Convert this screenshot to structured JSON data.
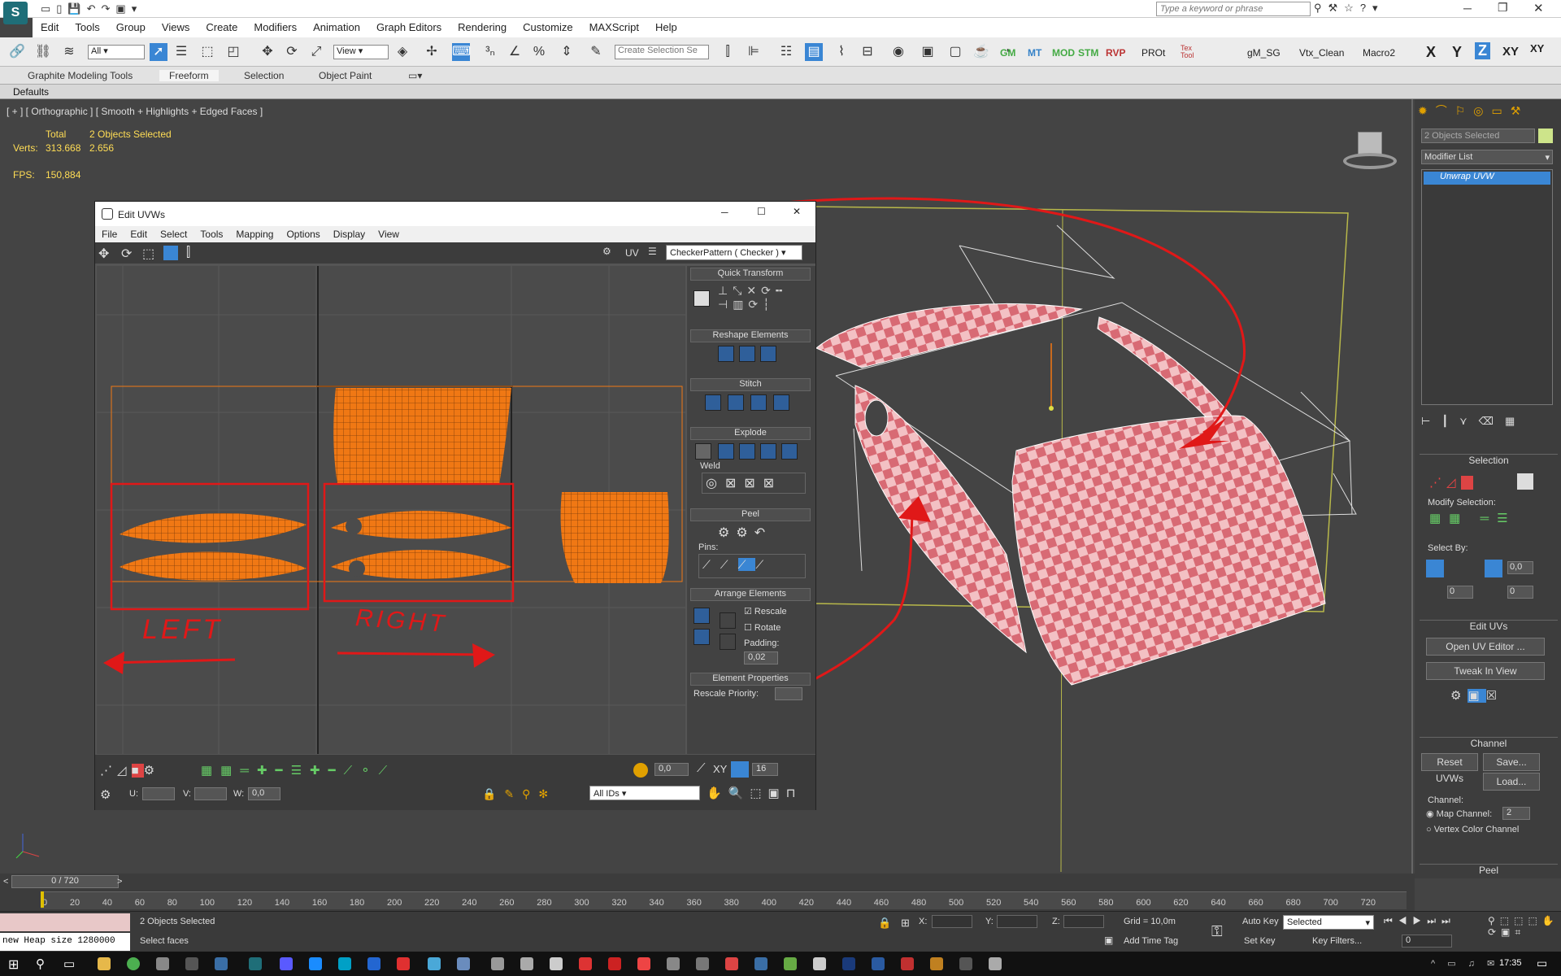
{
  "titlebar": {
    "search_placeholder": "Type a keyword or phrase"
  },
  "menu": [
    "Edit",
    "Tools",
    "Group",
    "Views",
    "Create",
    "Modifiers",
    "Animation",
    "Graph Editors",
    "Rendering",
    "Customize",
    "MAXScript",
    "Help"
  ],
  "toolbar": {
    "filter": "All",
    "refcoord": "View",
    "selset": "Create Selection Se",
    "scripts": [
      "GM",
      "MT",
      "MOD",
      "STM",
      "RVP",
      "PROt",
      "Tex Tool",
      "gM_SG",
      "Vtx_Clean",
      "Macro2"
    ],
    "axes": [
      "X",
      "Y",
      "Z",
      "XY",
      "XY"
    ]
  },
  "ribbon": {
    "tabs": [
      "Graphite Modeling Tools",
      "Freeform",
      "Selection",
      "Object Paint"
    ],
    "defaults": "Defaults"
  },
  "viewport": {
    "label": "[ + ] [ Orthographic ] [ Smooth + Highlights + Edged Faces ]",
    "total_label": "Total",
    "selected": "2 Objects Selected",
    "verts_label": "Verts:",
    "verts_total": "313.668",
    "verts_sel": "2.656",
    "fps_label": "FPS:",
    "fps": "150,884"
  },
  "uvw": {
    "title": "Edit UVWs",
    "menu": [
      "File",
      "Edit",
      "Select",
      "Tools",
      "Mapping",
      "Options",
      "Display",
      "View"
    ],
    "uv_label": "UV",
    "texture": "CheckerPattern  ( Checker )",
    "annotations": {
      "left": "LEFT",
      "right": "RIGHT"
    },
    "rollouts": {
      "quick": "Quick Transform",
      "reshape": "Reshape Elements",
      "stitch": "Stitch",
      "explode": "Explode",
      "weld": "Weld",
      "peel": "Peel",
      "pins": "Pins:",
      "arrange": "Arrange Elements",
      "rescale": "Rescale",
      "rotate": "Rotate",
      "padding": "Padding:",
      "padding_val": "0,02",
      "elprops": "Element Properties",
      "priority": "Rescale Priority:"
    },
    "bottom": {
      "spin1": "0,0",
      "spin2": "16",
      "xy": "XY",
      "u": "U:",
      "v": "V:",
      "w": "W:",
      "w_val": "0,0",
      "ids": "All IDs"
    }
  },
  "panel": {
    "objname": "2 Objects Selected",
    "modlist": "Modifier List",
    "modifier": "Unwrap UVW",
    "selection": "Selection",
    "modsel": "Modify Selection:",
    "selby": "Select By:",
    "sel_val": "0,0",
    "sel_v2": "0",
    "sel_v3": "0",
    "edituv": "Edit UVs",
    "open_editor": "Open UV Editor ...",
    "tweak": "Tweak In View",
    "channel": "Channel",
    "reset": "Reset UVWs",
    "save": "Save...",
    "load": "Load...",
    "channel_label": "Channel:",
    "map_channel": "Map Channel:",
    "map_val": "2",
    "vertex_color": "Vertex Color Channel",
    "peel": "Peel"
  },
  "timeline": {
    "frame": "0 / 720",
    "ticks": [
      "0",
      "20",
      "40",
      "60",
      "80",
      "100",
      "120",
      "140",
      "160",
      "180",
      "200",
      "220",
      "240",
      "260",
      "280",
      "300",
      "320",
      "340",
      "360",
      "380",
      "400",
      "420",
      "440",
      "460",
      "480",
      "500",
      "520",
      "540",
      "560",
      "580",
      "600",
      "620",
      "640",
      "660",
      "680",
      "700",
      "720"
    ]
  },
  "status": {
    "heap": "new Heap size 1280000",
    "selected": "2 Objects Selected",
    "prompt": "Select faces",
    "x": "X:",
    "y": "Y:",
    "z": "Z:",
    "grid": "Grid = 10,0m",
    "addtag": "Add Time Tag",
    "autokey": "Auto Key",
    "setkey": "Set Key",
    "keymode": "Selected",
    "keyfilters": "Key Filters...",
    "frame": "0"
  },
  "taskbar": {
    "clock": "17:35"
  }
}
